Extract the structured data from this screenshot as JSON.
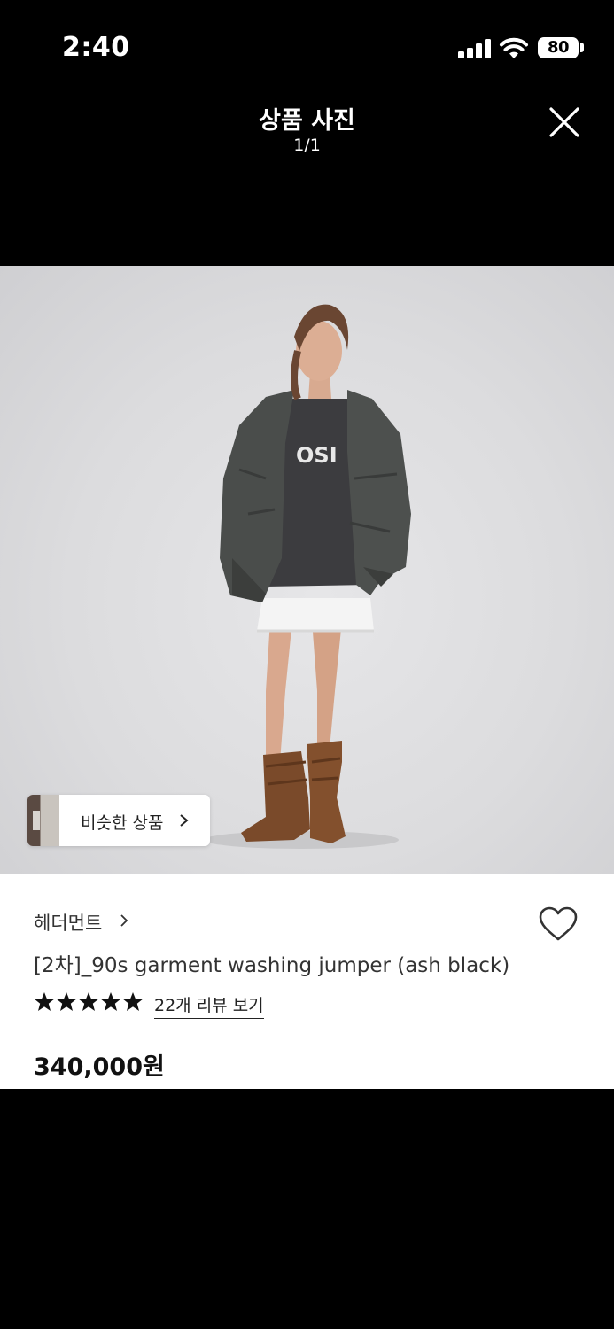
{
  "status_bar": {
    "time": "2:40",
    "battery": "80"
  },
  "header": {
    "title": "상품 사진",
    "counter": "1/1"
  },
  "photo": {
    "similar_button": "비슷한 상품"
  },
  "product": {
    "brand": "헤더먼트",
    "name": "[2차]_90s garment washing jumper (ash black)",
    "rating_stars": 5,
    "reviews_link": "22개 리뷰 보기",
    "price": "340,000원"
  }
}
